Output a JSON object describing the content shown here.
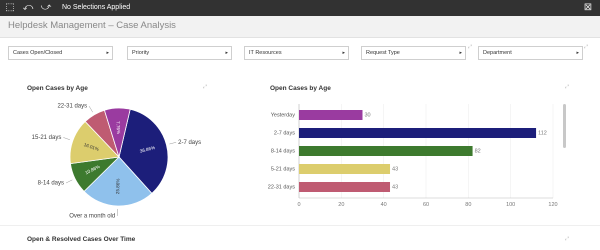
{
  "toolbar": {
    "selection_text": "No Selections Applied",
    "icons": [
      "lasso-select-icon",
      "step-back-icon",
      "step-forward-icon",
      "clear-selections-icon"
    ]
  },
  "header": {
    "title": "Helpdesk Management – Case Analysis"
  },
  "filters": [
    {
      "label": "Cases Open/Closed"
    },
    {
      "label": "Priority"
    },
    {
      "label": "IT Resources"
    },
    {
      "label": "Request Type"
    },
    {
      "label": "Department"
    }
  ],
  "colors": {
    "navy": "#1c1e7a",
    "light_blue": "#8fc1ec",
    "green": "#3d7a2e",
    "yellow": "#dccd6d",
    "rose": "#bf5b72",
    "purple": "#9a3ba0"
  },
  "chart_data": [
    {
      "type": "pie",
      "title": "Open Cases by Age",
      "slices": [
        {
          "label": "2-7 days",
          "value": 36.86,
          "value_label": "36.86%",
          "color": "#1c1e7a"
        },
        {
          "label": "Over a month old",
          "value": 25.86,
          "value_label": "25.86%",
          "color": "#8fc1ec"
        },
        {
          "label": "8-14 days",
          "value": 10.86,
          "value_label": "10.86%",
          "color": "#3d7a2e"
        },
        {
          "label": "15-21 days",
          "value": 16.01,
          "value_label": "16.01%",
          "color": "#dccd6d"
        },
        {
          "label": "22-31 days",
          "value": 7.76,
          "value_label": "",
          "color": "#bf5b72"
        },
        {
          "label": "",
          "value": 9.0,
          "value_label": "7.76%",
          "color": "#9a3ba0"
        }
      ]
    },
    {
      "type": "bar",
      "orientation": "horizontal",
      "title": "Open Cases by Age",
      "categories": [
        "Yesterday",
        "2-7 days",
        "8-14 days",
        "5-21 days",
        "22-31 days"
      ],
      "values": [
        30,
        112,
        82,
        43,
        43
      ],
      "colors": [
        "#9a3ba0",
        "#1c1e7a",
        "#3d7a2e",
        "#dccd6d",
        "#bf5b72"
      ],
      "xlim": [
        0,
        120
      ],
      "xticks": [
        0,
        20,
        40,
        60,
        80,
        100,
        120
      ],
      "grid": true
    }
  ],
  "bottom": {
    "title": "Open & Resolved Cases Over Time"
  }
}
